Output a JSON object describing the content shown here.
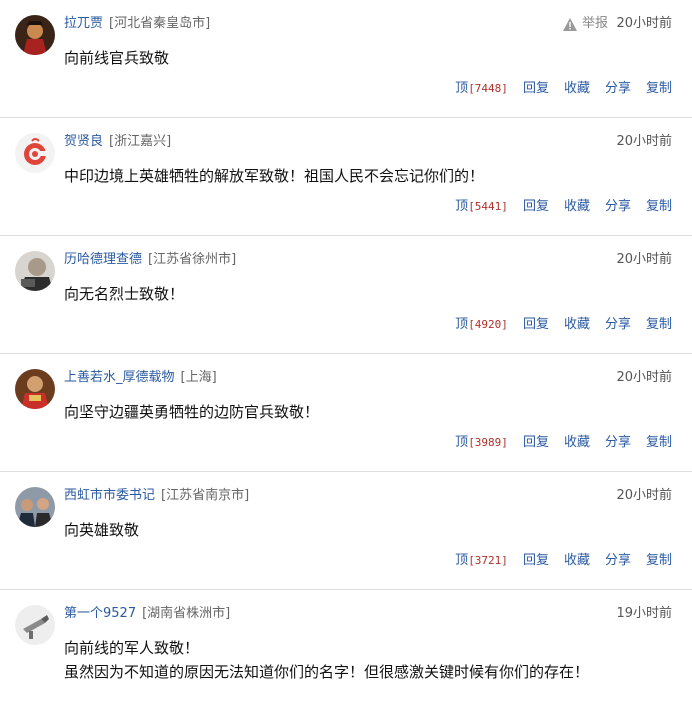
{
  "comments": [
    {
      "user": "拉兀贾",
      "location": "[河北省秦皇岛市]",
      "time": "20小时前",
      "report": "举报",
      "lines": [
        "向前线官兵致敬"
      ],
      "actions": {
        "up": "顶",
        "count": "[7448]",
        "reply": "回复",
        "collect": "收藏",
        "share": "分享",
        "copy": "复制"
      }
    },
    {
      "user": "贺贤良",
      "location": "[浙江嘉兴]",
      "time": "20小时前",
      "lines": [
        "中印边境上英雄牺牲的解放军致敬！祖国人民不会忘记你们的！"
      ],
      "actions": {
        "up": "顶",
        "count": "[5441]",
        "reply": "回复",
        "collect": "收藏",
        "share": "分享",
        "copy": "复制"
      }
    },
    {
      "user": "历哈德理查德",
      "location": "[江苏省徐州市]",
      "time": "20小时前",
      "lines": [
        "向无名烈士致敬！"
      ],
      "actions": {
        "up": "顶",
        "count": "[4920]",
        "reply": "回复",
        "collect": "收藏",
        "share": "分享",
        "copy": "复制"
      }
    },
    {
      "user": "上善若水_厚德载物",
      "location": "[上海]",
      "time": "20小时前",
      "lines": [
        "向坚守边疆英勇牺牲的边防官兵致敬！"
      ],
      "actions": {
        "up": "顶",
        "count": "[3989]",
        "reply": "回复",
        "collect": "收藏",
        "share": "分享",
        "copy": "复制"
      }
    },
    {
      "user": "西虹市市委书记",
      "location": "[江苏省南京市]",
      "time": "20小时前",
      "lines": [
        "向英雄致敬"
      ],
      "actions": {
        "up": "顶",
        "count": "[3721]",
        "reply": "回复",
        "collect": "收藏",
        "share": "分享",
        "copy": "复制"
      }
    },
    {
      "user": "第一个9527",
      "location": "[湖南省株洲市]",
      "time": "19小时前",
      "lines": [
        "向前线的军人致敬！",
        "虽然因为不知道的原因无法知道你们的名字！但很感激关键时候有你们的存在！"
      ]
    }
  ]
}
